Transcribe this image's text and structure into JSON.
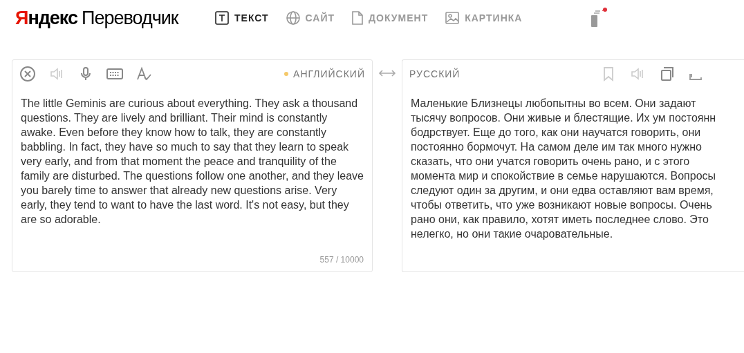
{
  "header": {
    "logo": {
      "brand": "Яндекс",
      "product": "Переводчик"
    },
    "tabs": [
      {
        "label": "ТЕКСТ",
        "kind": "text",
        "selected": true
      },
      {
        "label": "САЙТ",
        "kind": "site",
        "selected": false
      },
      {
        "label": "ДОКУМЕНТ",
        "kind": "document",
        "selected": false
      },
      {
        "label": "КАРТИНКА",
        "kind": "image",
        "selected": false
      }
    ]
  },
  "source": {
    "language": "АНГЛИЙСКИЙ",
    "text": "The little Geminis are curious about everything. They ask a thousand questions. They are lively and brilliant. Their mind is constantly awake. Even before they know how to talk, they are constantly babbling. In fact, they have so much to say that they learn to speak very early, and from that moment the peace and tranquility of the family are disturbed. The questions follow one another, and they leave you barely time to answer that already new questions arise. Very early, they tend to want to have the last word. It's not easy, but they are so adorable.",
    "counter": "557 / 10000"
  },
  "target": {
    "language": "РУССКИЙ",
    "lines": [
      "Маленькие Близнецы любопытны во всем. Они задают",
      "тысячу вопросов. Они живые и блестящие. Их ум постоянн",
      "бодрствует. Еще до того, как они научатся говорить, они",
      "постоянно бормочут. На самом деле им так много нужно",
      "сказать, что они учатся говорить очень рано, и с этого",
      "момента мир и спокойствие в семье нарушаются. Вопросы",
      "следуют один за другим, и они едва оставляют вам время,",
      "чтобы ответить, что уже возникают новые вопросы. Очень",
      "рано они, как правило, хотят иметь последнее слово. Это",
      "нелегко, но они такие очаровательные."
    ]
  }
}
